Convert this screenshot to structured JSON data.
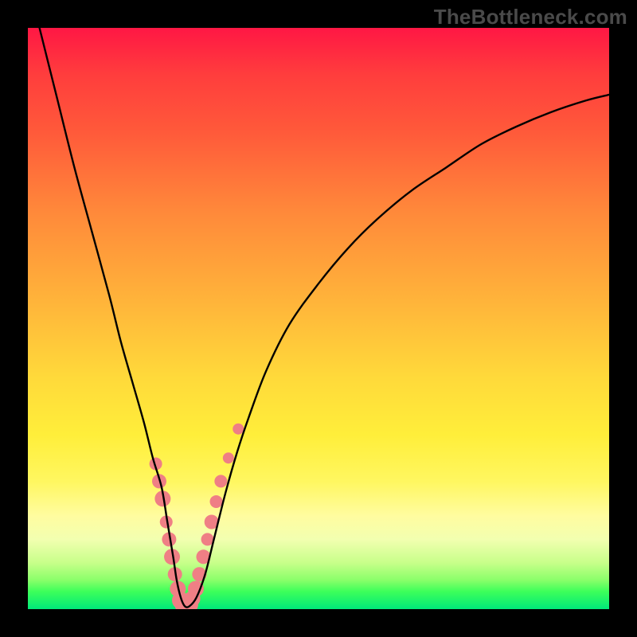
{
  "watermark": "TheBottleneck.com",
  "chart_data": {
    "type": "line",
    "title": "",
    "xlabel": "",
    "ylabel": "",
    "xlim": [
      0,
      100
    ],
    "ylim": [
      0,
      100
    ],
    "grid": false,
    "legend": false,
    "series": [
      {
        "name": "bottleneck-curve",
        "x": [
          2,
          5,
          8,
          11,
          14,
          16,
          18,
          20,
          21.5,
          23,
          24,
          25,
          25.6,
          26.3,
          27,
          27.8,
          29,
          30.5,
          32,
          34,
          36,
          38,
          41,
          45,
          50,
          55,
          60,
          66,
          72,
          78,
          84,
          90,
          96,
          100
        ],
        "y": [
          100,
          88,
          76,
          65,
          54,
          46,
          39,
          32,
          26,
          21,
          15,
          9,
          5,
          2,
          0.5,
          0.5,
          2,
          6,
          12,
          20,
          27,
          33,
          41,
          49,
          56,
          62,
          67,
          72,
          76,
          80,
          83,
          85.5,
          87.5,
          88.5
        ]
      }
    ],
    "highlight_points": {
      "name": "sample-points",
      "color": "#ef7f85",
      "radius_range": [
        6,
        12
      ],
      "points": [
        {
          "x": 22.0,
          "y": 25,
          "r": 8
        },
        {
          "x": 22.6,
          "y": 22,
          "r": 9
        },
        {
          "x": 23.2,
          "y": 19,
          "r": 10
        },
        {
          "x": 23.8,
          "y": 15,
          "r": 8
        },
        {
          "x": 24.3,
          "y": 12,
          "r": 9
        },
        {
          "x": 24.8,
          "y": 9,
          "r": 10
        },
        {
          "x": 25.3,
          "y": 6,
          "r": 9
        },
        {
          "x": 25.8,
          "y": 3.5,
          "r": 10
        },
        {
          "x": 26.3,
          "y": 1.5,
          "r": 11
        },
        {
          "x": 26.8,
          "y": 0.7,
          "r": 11
        },
        {
          "x": 27.3,
          "y": 0.6,
          "r": 11
        },
        {
          "x": 27.8,
          "y": 0.8,
          "r": 11
        },
        {
          "x": 28.3,
          "y": 1.8,
          "r": 10
        },
        {
          "x": 28.9,
          "y": 3.5,
          "r": 10
        },
        {
          "x": 29.5,
          "y": 6,
          "r": 9
        },
        {
          "x": 30.2,
          "y": 9,
          "r": 9
        },
        {
          "x": 30.9,
          "y": 12,
          "r": 8
        },
        {
          "x": 31.6,
          "y": 15,
          "r": 9
        },
        {
          "x": 32.4,
          "y": 18.5,
          "r": 8
        },
        {
          "x": 33.2,
          "y": 22,
          "r": 8
        },
        {
          "x": 34.5,
          "y": 26,
          "r": 7
        },
        {
          "x": 36.2,
          "y": 31,
          "r": 7
        }
      ]
    },
    "background_gradient": {
      "top_color": "#ff1744",
      "mid_color": "#ffd93a",
      "bottom_color": "#00e87a"
    }
  }
}
